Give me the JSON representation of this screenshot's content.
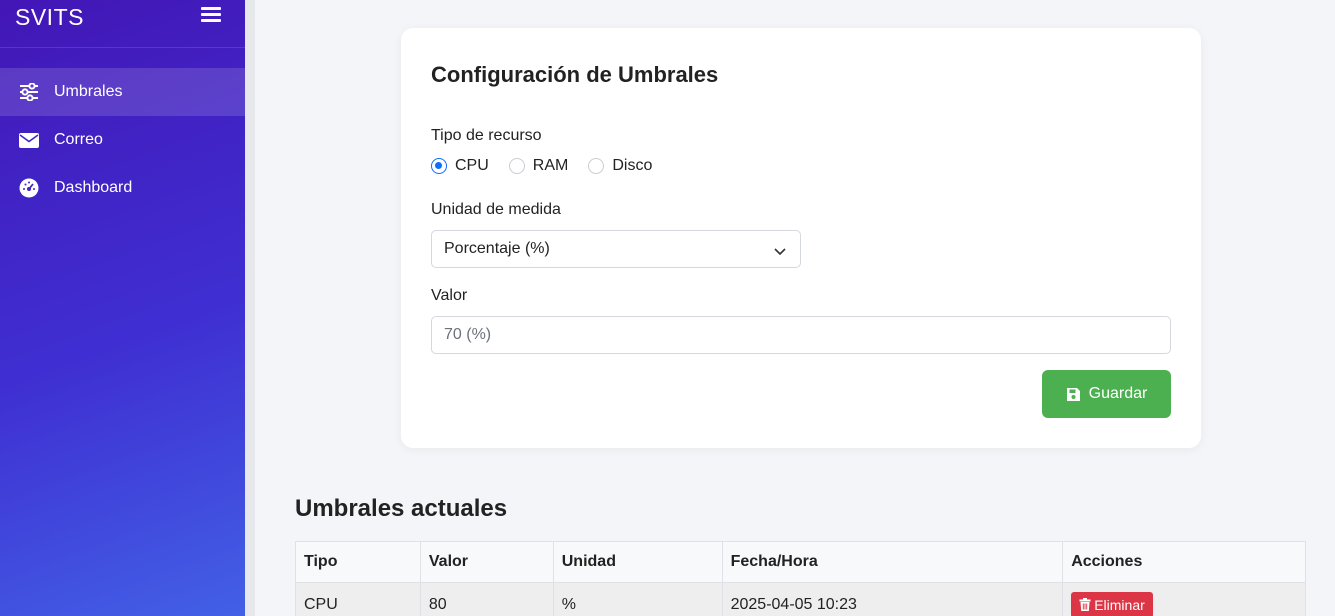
{
  "sidebar": {
    "brand": "SVITS",
    "items": [
      {
        "label": "Umbrales",
        "icon": "sliders-icon"
      },
      {
        "label": "Correo",
        "icon": "envelope-icon"
      },
      {
        "label": "Dashboard",
        "icon": "gauge-icon"
      }
    ]
  },
  "form": {
    "title": "Configuración de Umbrales",
    "resource_label": "Tipo de recurso",
    "resource_options": [
      "CPU",
      "RAM",
      "Disco"
    ],
    "resource_selected": "CPU",
    "unit_label": "Unidad de medida",
    "unit_selected": "Porcentaje (%)",
    "value_label": "Valor",
    "value_placeholder": "70 (%)",
    "value": "",
    "save_label": "Guardar"
  },
  "table": {
    "title": "Umbrales actuales",
    "headers": [
      "Tipo",
      "Valor",
      "Unidad",
      "Fecha/Hora",
      "Acciones"
    ],
    "rows": [
      {
        "tipo": "CPU",
        "valor": "80",
        "unidad": "%",
        "fecha": "2025-04-05 10:23",
        "action": "Eliminar"
      }
    ]
  },
  "colors": {
    "accent": "#0d6efd",
    "save": "#4caf50",
    "delete": "#dc3545",
    "sidebar_top": "#4316b6",
    "sidebar_bottom": "#4260e6"
  }
}
